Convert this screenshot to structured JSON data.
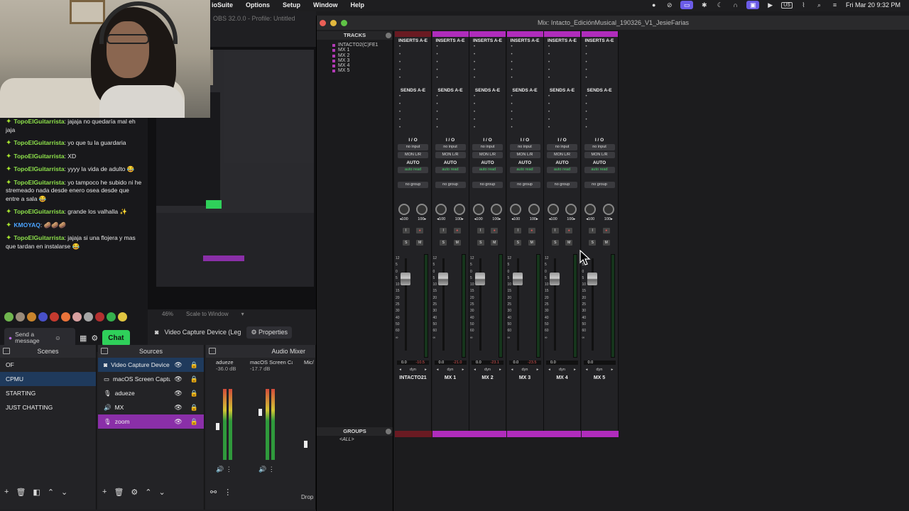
{
  "menubar": {
    "items": [
      "ioSuite",
      "Options",
      "Setup",
      "Window",
      "Help"
    ],
    "clock": "Fri Mar 20  9:32 PM",
    "input_source": "US"
  },
  "obs": {
    "title": "OBS 32.0.0 - Profile: Untitled",
    "zoom": "46%",
    "scale_mode": "Scale to Window",
    "selected_source_label": "Video Capture Device (Legacy)",
    "properties_label": "Properties",
    "scenes_header": "Scenes",
    "sources_header": "Sources",
    "mixer_header": "Audio Mixer",
    "scenes": [
      "OF",
      "CPMU",
      "STARTING",
      "JUST CHATTING"
    ],
    "selected_scene": "CPMU",
    "sources": [
      {
        "name": "Video Capture Device (L",
        "icon": "camera-icon"
      },
      {
        "name": "macOS Screen Capture",
        "icon": "monitor-icon"
      },
      {
        "name": "adueze",
        "icon": "mic-icon"
      },
      {
        "name": "MX",
        "icon": "speaker-icon"
      },
      {
        "name": "zoom",
        "icon": "mic-icon"
      }
    ],
    "mixer": [
      {
        "name": "adueze",
        "db": "-36.0 dB"
      },
      {
        "name": "macOS Screen Cap",
        "db": "-17.7 dB"
      },
      {
        "name": "Mic/",
        "db": ""
      }
    ],
    "drop_label": "Drop"
  },
  "chat": {
    "messages": [
      {
        "user": "TopoElGuitarrista",
        "text": ": jajaja no quedaría mal eh jaja"
      },
      {
        "user": "TopoElGuitarrista",
        "text": ": yo que tu la guardaria"
      },
      {
        "user": "TopoElGuitarrista",
        "text": ": XD"
      },
      {
        "user": "TopoElGuitarrista",
        "text": ": yyyy la vida de adulto 😂"
      },
      {
        "user": "TopoElGuitarrista",
        "text": ": yo tampoco he subido ni he stremeado nada desde enero osea desde que entre a sala 😂"
      },
      {
        "user": "TopoElGuitarrista",
        "text": ": grande los valhalla ✨"
      },
      {
        "user": "KMOYAQ",
        "text": ": 🥔🥔🥔"
      },
      {
        "user": "TopoElGuitarrista",
        "text": ": jajaja si una flojera y mas que tardan en instalarse 😂"
      }
    ],
    "input_placeholder": "Send a message",
    "send_label": "Chat"
  },
  "protools": {
    "window_title": "Mix: Intacto_EdiciónMusical_190326_V1_JesieFarias",
    "tracks_header": "TRACKS",
    "groups_header": "GROUPS",
    "track_list": [
      "INTACTO2(C)FE1",
      "MX 1",
      "MX 2",
      "MX 3",
      "MX 4",
      "MX 5"
    ],
    "group_list": [
      "<ALL>"
    ],
    "strips": [
      {
        "name": "INTACTO21",
        "vol": "0.0",
        "peak": "-10.5",
        "top_color": "red"
      },
      {
        "name": "MX 1",
        "vol": "0.0",
        "peak": "-21.0",
        "top_color": "magenta"
      },
      {
        "name": "MX 2",
        "vol": "0.0",
        "peak": "-23.1",
        "top_color": "magenta"
      },
      {
        "name": "MX 3",
        "vol": "0.0",
        "peak": "-23.5",
        "top_color": "magenta"
      },
      {
        "name": "MX 4",
        "vol": "0.0",
        "peak": "",
        "top_color": "magenta"
      },
      {
        "name": "MX 5",
        "vol": "0.0",
        "peak": "",
        "top_color": "magenta"
      }
    ],
    "labels": {
      "inserts": "INSERTS A-E",
      "sends": "SENDS A-E",
      "io": "I / O",
      "input": "no input",
      "output": "MON L/R",
      "auto": "AUTO",
      "auto_mode": "auto read",
      "group": "no group",
      "pan_l": "◂100",
      "pan_r": "100▸",
      "dyn": "dyn"
    }
  },
  "colors": {
    "accent_magenta": "#b02cbc",
    "chat_green": "#2fd05a",
    "scene_selected": "#1f3a5c",
    "source_selected": "#8a2fa8"
  }
}
